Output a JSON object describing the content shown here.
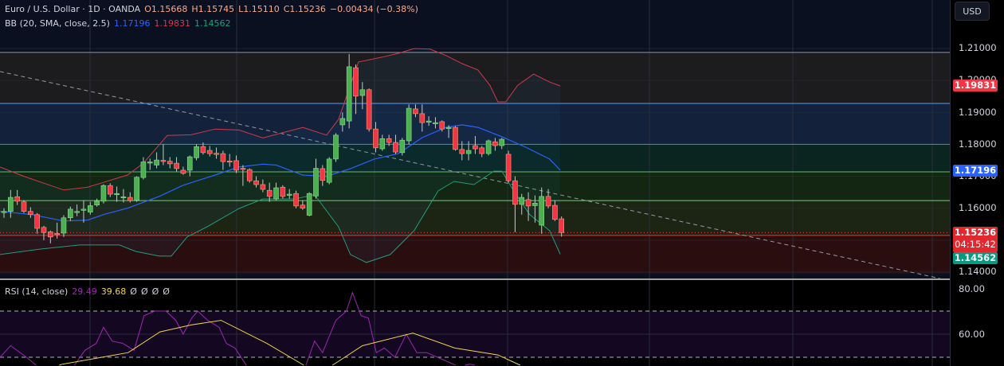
{
  "header": {
    "symbol": "Euro / U.S. Dollar · 1D · OANDA",
    "open": "O1.15668",
    "high": "H1.15745",
    "low": "L1.15110",
    "close": "C1.15236",
    "change": "−0.00434 (−0.38%)"
  },
  "bb_legend": {
    "label": "BB (20, SMA, close, 2.5)",
    "basis": "1.17196",
    "upper": "1.19831",
    "lower": "1.14562"
  },
  "rsi_legend": {
    "label": "RSI (14, close)",
    "rsi": "29.49",
    "ma": "39.68",
    "v1": "Ø",
    "v2": "Ø",
    "v3": "Ø",
    "v4": "Ø"
  },
  "axis": {
    "currency": "USD",
    "ticks": [
      "1.21000",
      "1.20000",
      "1.19000",
      "1.18000",
      "1.17000",
      "1.16000",
      "1.14000"
    ],
    "rsi_ticks": [
      "80.00",
      "60.00"
    ],
    "tag_upper": "1.19831",
    "tag_basis": "1.17196",
    "tag_close": "1.15236",
    "tag_countdown": "04:15:42",
    "tag_lower": "1.14562"
  },
  "colors": {
    "up": "#4caf50",
    "down": "#f23645",
    "upper": "#d0394b",
    "basis": "#2962ff",
    "lower": "#1e9e7e",
    "rsi": "#9c27b0",
    "rsi_ma": "#f0d540"
  },
  "chart_data": {
    "type": "candlestick",
    "price_range": [
      1.14,
      1.21
    ],
    "candles": [
      [
        1.1588,
        1.16,
        1.157,
        1.159
      ],
      [
        1.159,
        1.1657,
        1.157,
        1.1634
      ],
      [
        1.1636,
        1.1657,
        1.161,
        1.1622
      ],
      [
        1.162,
        1.1625,
        1.1585,
        1.159
      ],
      [
        1.159,
        1.1603,
        1.157,
        1.158
      ],
      [
        1.158,
        1.1585,
        1.152,
        1.1537
      ],
      [
        1.154,
        1.1545,
        1.15,
        1.1524
      ],
      [
        1.1526,
        1.153,
        1.149,
        1.151
      ],
      [
        1.1521,
        1.1555,
        1.1505,
        1.152
      ],
      [
        1.1522,
        1.1578,
        1.151,
        1.157
      ],
      [
        1.157,
        1.1605,
        1.156,
        1.1597
      ],
      [
        1.1588,
        1.1612,
        1.1575,
        1.159
      ],
      [
        1.1595,
        1.1625,
        1.1555,
        1.1597
      ],
      [
        1.1588,
        1.162,
        1.158,
        1.1608
      ],
      [
        1.161,
        1.163,
        1.1605,
        1.1622
      ],
      [
        1.1622,
        1.1675,
        1.1615,
        1.1671
      ],
      [
        1.1671,
        1.1678,
        1.1635,
        1.1644
      ],
      [
        1.1643,
        1.1668,
        1.162,
        1.1646
      ],
      [
        1.1634,
        1.166,
        1.1618,
        1.1636
      ],
      [
        1.1634,
        1.165,
        1.1618,
        1.1624
      ],
      [
        1.1625,
        1.17,
        1.162,
        1.1697
      ],
      [
        1.1696,
        1.176,
        1.169,
        1.1745
      ],
      [
        1.1743,
        1.1755,
        1.172,
        1.1745
      ],
      [
        1.1735,
        1.1775,
        1.1725,
        1.1751
      ],
      [
        1.175,
        1.18,
        1.1735,
        1.1748
      ],
      [
        1.1747,
        1.176,
        1.1725,
        1.1739
      ],
      [
        1.1741,
        1.176,
        1.1715,
        1.1724
      ],
      [
        1.1719,
        1.173,
        1.1705,
        1.1709
      ],
      [
        1.1719,
        1.1765,
        1.17,
        1.1761
      ],
      [
        1.1758,
        1.18,
        1.175,
        1.1793
      ],
      [
        1.1793,
        1.1806,
        1.1768,
        1.1774
      ],
      [
        1.1781,
        1.1795,
        1.1762,
        1.1771
      ],
      [
        1.1772,
        1.179,
        1.1755,
        1.1771
      ],
      [
        1.1771,
        1.178,
        1.172,
        1.1746
      ],
      [
        1.1748,
        1.177,
        1.173,
        1.1746
      ],
      [
        1.1749,
        1.1765,
        1.171,
        1.1719
      ],
      [
        1.1725,
        1.1735,
        1.167,
        1.1724
      ],
      [
        1.1721,
        1.1725,
        1.168,
        1.1686
      ],
      [
        1.1686,
        1.17,
        1.1665,
        1.1674
      ],
      [
        1.1674,
        1.169,
        1.165,
        1.1659
      ],
      [
        1.1656,
        1.168,
        1.162,
        1.1637
      ],
      [
        1.1629,
        1.168,
        1.1625,
        1.1664
      ],
      [
        1.1666,
        1.1672,
        1.163,
        1.1637
      ],
      [
        1.1644,
        1.166,
        1.163,
        1.1644
      ],
      [
        1.1646,
        1.1655,
        1.16,
        1.1607
      ],
      [
        1.161,
        1.1625,
        1.1595,
        1.16
      ],
      [
        1.1578,
        1.165,
        1.1575,
        1.1646
      ],
      [
        1.1638,
        1.1755,
        1.163,
        1.1725
      ],
      [
        1.1724,
        1.1735,
        1.167,
        1.1687
      ],
      [
        1.1681,
        1.176,
        1.1675,
        1.1754
      ],
      [
        1.1754,
        1.1835,
        1.1745,
        1.1829
      ],
      [
        1.1861,
        1.19,
        1.184,
        1.1881
      ],
      [
        1.1873,
        1.2083,
        1.185,
        1.2043
      ],
      [
        1.204,
        1.205,
        1.1895,
        1.1951
      ],
      [
        1.1953,
        1.1995,
        1.191,
        1.1971
      ],
      [
        1.1971,
        1.1975,
        1.184,
        1.1848
      ],
      [
        1.1848,
        1.187,
        1.1775,
        1.1789
      ],
      [
        1.1786,
        1.183,
        1.178,
        1.1818
      ],
      [
        1.1818,
        1.183,
        1.1795,
        1.1806
      ],
      [
        1.1806,
        1.183,
        1.177,
        1.1776
      ],
      [
        1.1774,
        1.182,
        1.1765,
        1.1813
      ],
      [
        1.1811,
        1.1925,
        1.18,
        1.1913
      ],
      [
        1.1911,
        1.1925,
        1.1885,
        1.1896
      ],
      [
        1.1896,
        1.1925,
        1.184,
        1.1868
      ],
      [
        1.1873,
        1.1888,
        1.1858,
        1.1873
      ],
      [
        1.1868,
        1.1885,
        1.185,
        1.1868
      ],
      [
        1.1871,
        1.1875,
        1.184,
        1.1848
      ],
      [
        1.1853,
        1.186,
        1.182,
        1.1853
      ],
      [
        1.1853,
        1.1857,
        1.178,
        1.1784
      ],
      [
        1.1784,
        1.181,
        1.175,
        1.1771
      ],
      [
        1.1771,
        1.181,
        1.175,
        1.1781
      ],
      [
        1.1796,
        1.1826,
        1.177,
        1.1786
      ],
      [
        1.1789,
        1.1795,
        1.176,
        1.1771
      ],
      [
        1.1771,
        1.1815,
        1.1765,
        1.1811
      ],
      [
        1.1808,
        1.182,
        1.178,
        1.1796
      ],
      [
        1.1796,
        1.182,
        1.1785,
        1.1816
      ],
      [
        1.1769,
        1.178,
        1.168,
        1.1686
      ],
      [
        1.1686,
        1.17,
        1.1525,
        1.1612
      ],
      [
        1.1612,
        1.1645,
        1.158,
        1.1634
      ],
      [
        1.1627,
        1.165,
        1.156,
        1.1607
      ],
      [
        1.1608,
        1.164,
        1.1555,
        1.1616
      ],
      [
        1.1547,
        1.1665,
        1.152,
        1.1637
      ],
      [
        1.1637,
        1.166,
        1.16,
        1.1607
      ],
      [
        1.1609,
        1.1625,
        1.156,
        1.1565
      ],
      [
        1.15668,
        1.15745,
        1.1511,
        1.15236
      ]
    ],
    "bb_upper": [
      [
        -0.6,
        1.1729
      ],
      [
        3,
        1.17
      ],
      [
        9,
        1.1657
      ],
      [
        12.6,
        1.1666
      ],
      [
        18.6,
        1.1704
      ],
      [
        21,
        1.1741
      ],
      [
        24.6,
        1.1828
      ],
      [
        28.2,
        1.183
      ],
      [
        31.8,
        1.1848
      ],
      [
        35.4,
        1.1845
      ],
      [
        39,
        1.182
      ],
      [
        40.8,
        1.183
      ],
      [
        45,
        1.1853
      ],
      [
        48.6,
        1.1829
      ],
      [
        50.4,
        1.1878
      ],
      [
        53.4,
        1.2058
      ],
      [
        57,
        1.2073
      ],
      [
        59.4,
        1.2085
      ],
      [
        61.8,
        1.21
      ],
      [
        64.2,
        1.2098
      ],
      [
        66.6,
        1.2078
      ],
      [
        69,
        1.2053
      ],
      [
        71.4,
        1.2033
      ],
      [
        73.2,
        1.1985
      ],
      [
        74.4,
        1.1933
      ],
      [
        75.6,
        1.1933
      ],
      [
        77.4,
        1.1985
      ],
      [
        79.8,
        1.202
      ],
      [
        82.2,
        1.1995
      ],
      [
        83.8,
        1.1983
      ]
    ],
    "bb_basis": [
      [
        -0.6,
        1.159
      ],
      [
        4.2,
        1.158
      ],
      [
        9,
        1.156
      ],
      [
        12.6,
        1.1563
      ],
      [
        15,
        1.158
      ],
      [
        18.6,
        1.16
      ],
      [
        23.4,
        1.1637
      ],
      [
        27,
        1.1672
      ],
      [
        31.8,
        1.1704
      ],
      [
        35.4,
        1.1729
      ],
      [
        39,
        1.1738
      ],
      [
        41,
        1.1735
      ],
      [
        45,
        1.1704
      ],
      [
        48.6,
        1.17
      ],
      [
        52.2,
        1.1724
      ],
      [
        55.8,
        1.1754
      ],
      [
        59.4,
        1.1771
      ],
      [
        63,
        1.1821
      ],
      [
        66.6,
        1.1853
      ],
      [
        69,
        1.1861
      ],
      [
        71.4,
        1.1853
      ],
      [
        75,
        1.1824
      ],
      [
        78.6,
        1.1791
      ],
      [
        82.2,
        1.1754
      ],
      [
        83.8,
        1.1719
      ]
    ],
    "bb_lower": [
      [
        -0.6,
        1.1455
      ],
      [
        5.4,
        1.1472
      ],
      [
        11.4,
        1.1485
      ],
      [
        17.4,
        1.1485
      ],
      [
        19.8,
        1.1465
      ],
      [
        23.4,
        1.145
      ],
      [
        25.2,
        1.145
      ],
      [
        27.6,
        1.151
      ],
      [
        30.6,
        1.1542
      ],
      [
        35.4,
        1.1599
      ],
      [
        39,
        1.1629
      ],
      [
        43.8,
        1.1629
      ],
      [
        46.8,
        1.1642
      ],
      [
        50.4,
        1.1542
      ],
      [
        52.2,
        1.1455
      ],
      [
        54.6,
        1.143
      ],
      [
        58.2,
        1.1455
      ],
      [
        61.8,
        1.153
      ],
      [
        65.4,
        1.1654
      ],
      [
        67.8,
        1.1684
      ],
      [
        70.8,
        1.1674
      ],
      [
        73.8,
        1.1716
      ],
      [
        75,
        1.1716
      ],
      [
        76.8,
        1.1654
      ],
      [
        79.2,
        1.158
      ],
      [
        82.2,
        1.153
      ],
      [
        83.8,
        1.1456
      ]
    ],
    "levels": [
      {
        "price": 1.2088,
        "color": "#9598a1",
        "zone": "#1c1c1e"
      },
      {
        "price": 1.1928,
        "color": "#5b9cf6",
        "zone": "#14213a"
      },
      {
        "price": 1.18,
        "color": "#26a69a",
        "zone": "#0a2420"
      },
      {
        "price": 1.1714,
        "color": "#66bb6a",
        "zone": "#122612"
      },
      {
        "price": 1.1624,
        "color": "#81c784",
        "zone": "#1c2414"
      },
      {
        "price": 1.1515,
        "color": "#e53935",
        "zone": "#2a0d0f"
      }
    ],
    "zone_bottom": 1.1395,
    "trendline": [
      [
        -0.6,
        1.2028
      ],
      [
        141,
        1.138
      ]
    ],
    "rsi_range": [
      46,
      82
    ],
    "rsi_levels": [
      70,
      50
    ],
    "rsi": [
      [
        -0.6,
        50
      ],
      [
        1,
        55
      ],
      [
        3.4,
        50
      ],
      [
        5.9,
        44
      ],
      [
        9,
        40
      ],
      [
        12.2,
        53
      ],
      [
        13.9,
        56
      ],
      [
        15,
        63
      ],
      [
        16.3,
        57
      ],
      [
        17.9,
        56
      ],
      [
        19.6,
        53
      ],
      [
        21.1,
        68
      ],
      [
        22.7,
        70
      ],
      [
        24.4,
        70
      ],
      [
        25.9,
        66
      ],
      [
        27,
        60
      ],
      [
        28.3,
        67
      ],
      [
        29.2,
        70
      ],
      [
        30.7,
        66
      ],
      [
        32.4,
        63
      ],
      [
        33.5,
        56
      ],
      [
        34.8,
        54
      ],
      [
        36.4,
        47
      ],
      [
        37.8,
        42
      ],
      [
        41.2,
        37
      ],
      [
        44.4,
        38
      ],
      [
        46.8,
        57
      ],
      [
        48,
        52
      ],
      [
        50,
        66
      ],
      [
        51.6,
        70
      ],
      [
        52.5,
        78
      ],
      [
        53.8,
        68
      ],
      [
        54.9,
        67
      ],
      [
        56.1,
        52
      ],
      [
        57.3,
        54
      ],
      [
        58.9,
        50
      ],
      [
        60.6,
        60
      ],
      [
        62.2,
        52
      ],
      [
        63.7,
        52
      ],
      [
        66.1,
        49
      ],
      [
        68.5,
        46
      ],
      [
        70.2,
        47
      ],
      [
        71.8,
        46
      ],
      [
        75,
        44
      ],
      [
        76.2,
        38
      ],
      [
        78.6,
        34
      ],
      [
        82.2,
        30
      ],
      [
        84,
        29.49
      ]
    ],
    "rsi_ma": [
      [
        6.6,
        45
      ],
      [
        8.8,
        47
      ],
      [
        18.7,
        52
      ],
      [
        23.5,
        61
      ],
      [
        28.2,
        64
      ],
      [
        32.7,
        66
      ],
      [
        39.6,
        56
      ],
      [
        45.5,
        46
      ],
      [
        49.2,
        46
      ],
      [
        54,
        55
      ],
      [
        61.6,
        60.5
      ],
      [
        67.9,
        54
      ],
      [
        74.4,
        51
      ],
      [
        78.2,
        46
      ],
      [
        83.4,
        40
      ]
    ]
  }
}
